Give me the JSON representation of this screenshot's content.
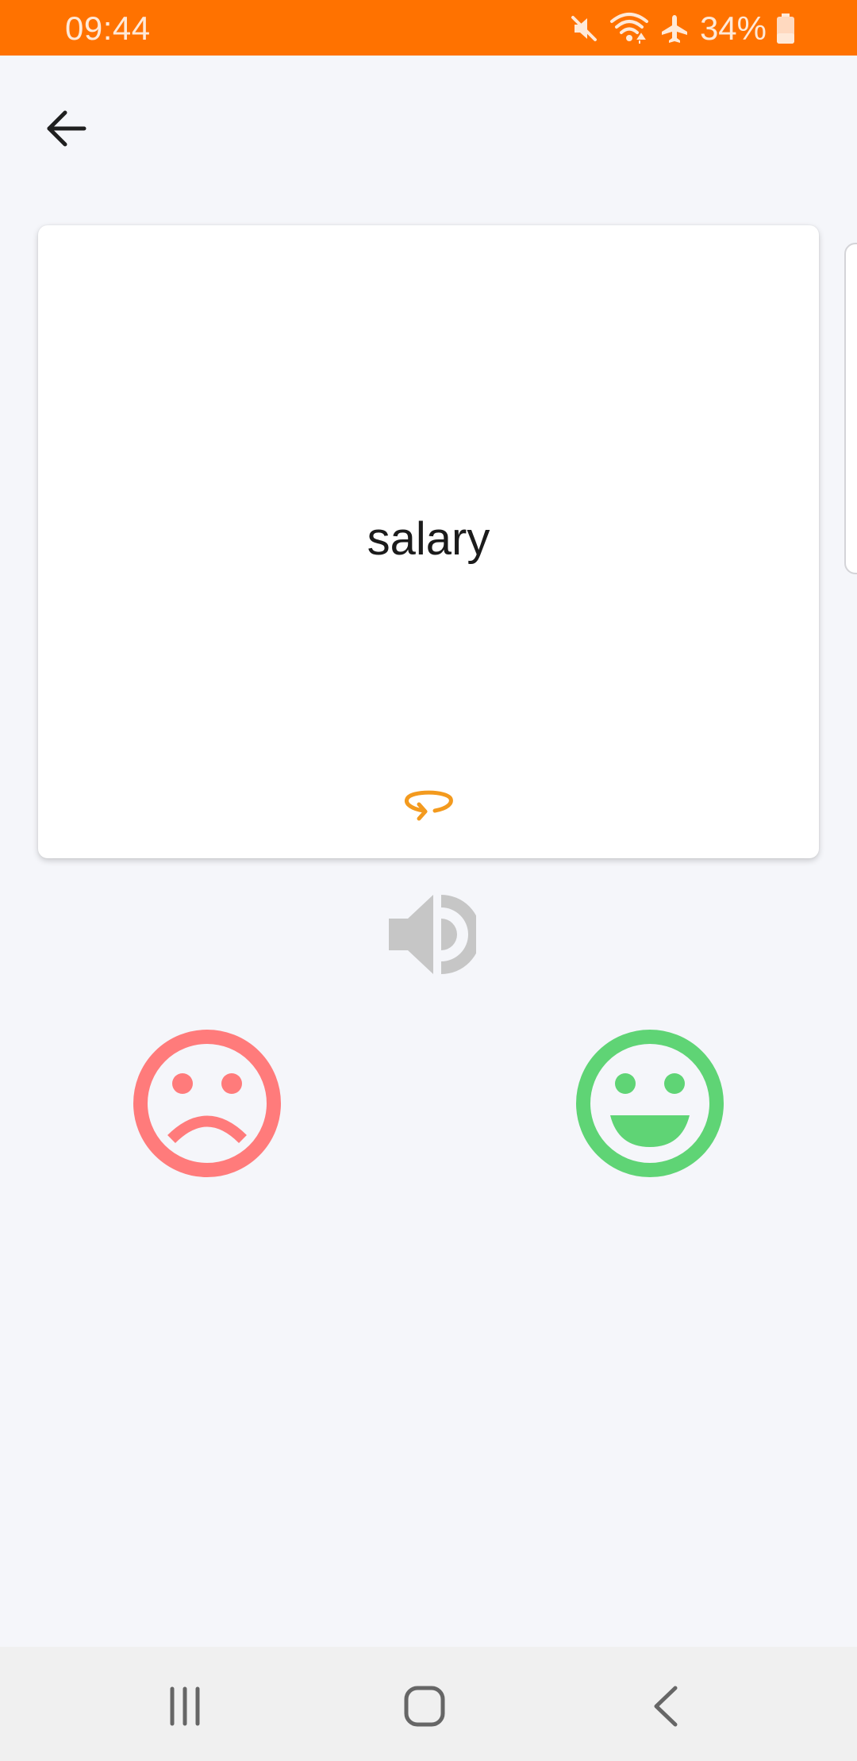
{
  "status_bar": {
    "time": "09:44",
    "battery_percent": "34%",
    "icons": [
      "mute-icon",
      "wifi-icon",
      "airplane-mode-icon",
      "battery-icon"
    ],
    "background_color": "#ff7200"
  },
  "header": {
    "back_icon": "arrow-left-icon"
  },
  "flashcard": {
    "word": "salary",
    "flip_icon": "flip-rotate-icon",
    "flip_icon_color": "#f39a1e"
  },
  "actions": {
    "speaker_icon": "speaker-icon",
    "dont_know_icon": "sad-face-icon",
    "dont_know_color": "#ff7b7b",
    "know_icon": "happy-face-icon",
    "know_color": "#5fd475"
  },
  "nav_bar": {
    "items": [
      "recent-apps-icon",
      "home-icon",
      "back-icon"
    ]
  }
}
